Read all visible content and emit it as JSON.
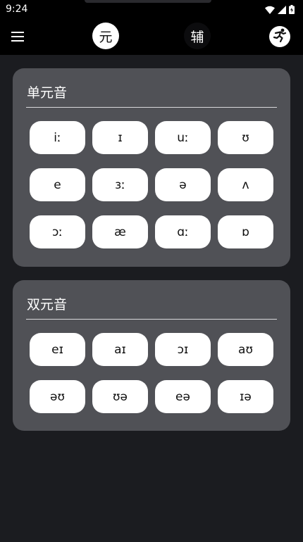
{
  "status_bar": {
    "time": "9:24",
    "icons": [
      "wifi-icon",
      "signal-icon",
      "battery-icon"
    ]
  },
  "app_bar": {
    "menu_icon": "menu-icon",
    "tabs": [
      {
        "label": "元",
        "selected": true
      },
      {
        "label": "辅",
        "selected": false
      }
    ],
    "action_icon": "running-person-icon"
  },
  "monophthongs": {
    "title": "单元音",
    "symbols": [
      "iː",
      "ɪ",
      "uː",
      "ʊ",
      "e",
      "ɜː",
      "ə",
      "ʌ",
      "ɔː",
      "æ",
      "ɑː",
      "ɒ"
    ]
  },
  "diphthongs": {
    "title": "双元音",
    "symbols": [
      "eɪ",
      "aɪ",
      "ɔɪ",
      "aʊ",
      "əʊ",
      "ʊə",
      "eə",
      "ɪə"
    ]
  },
  "colors": {
    "background": "#1b1c20",
    "card": "#505156",
    "bar": "#000000",
    "button": "#ffffff"
  }
}
